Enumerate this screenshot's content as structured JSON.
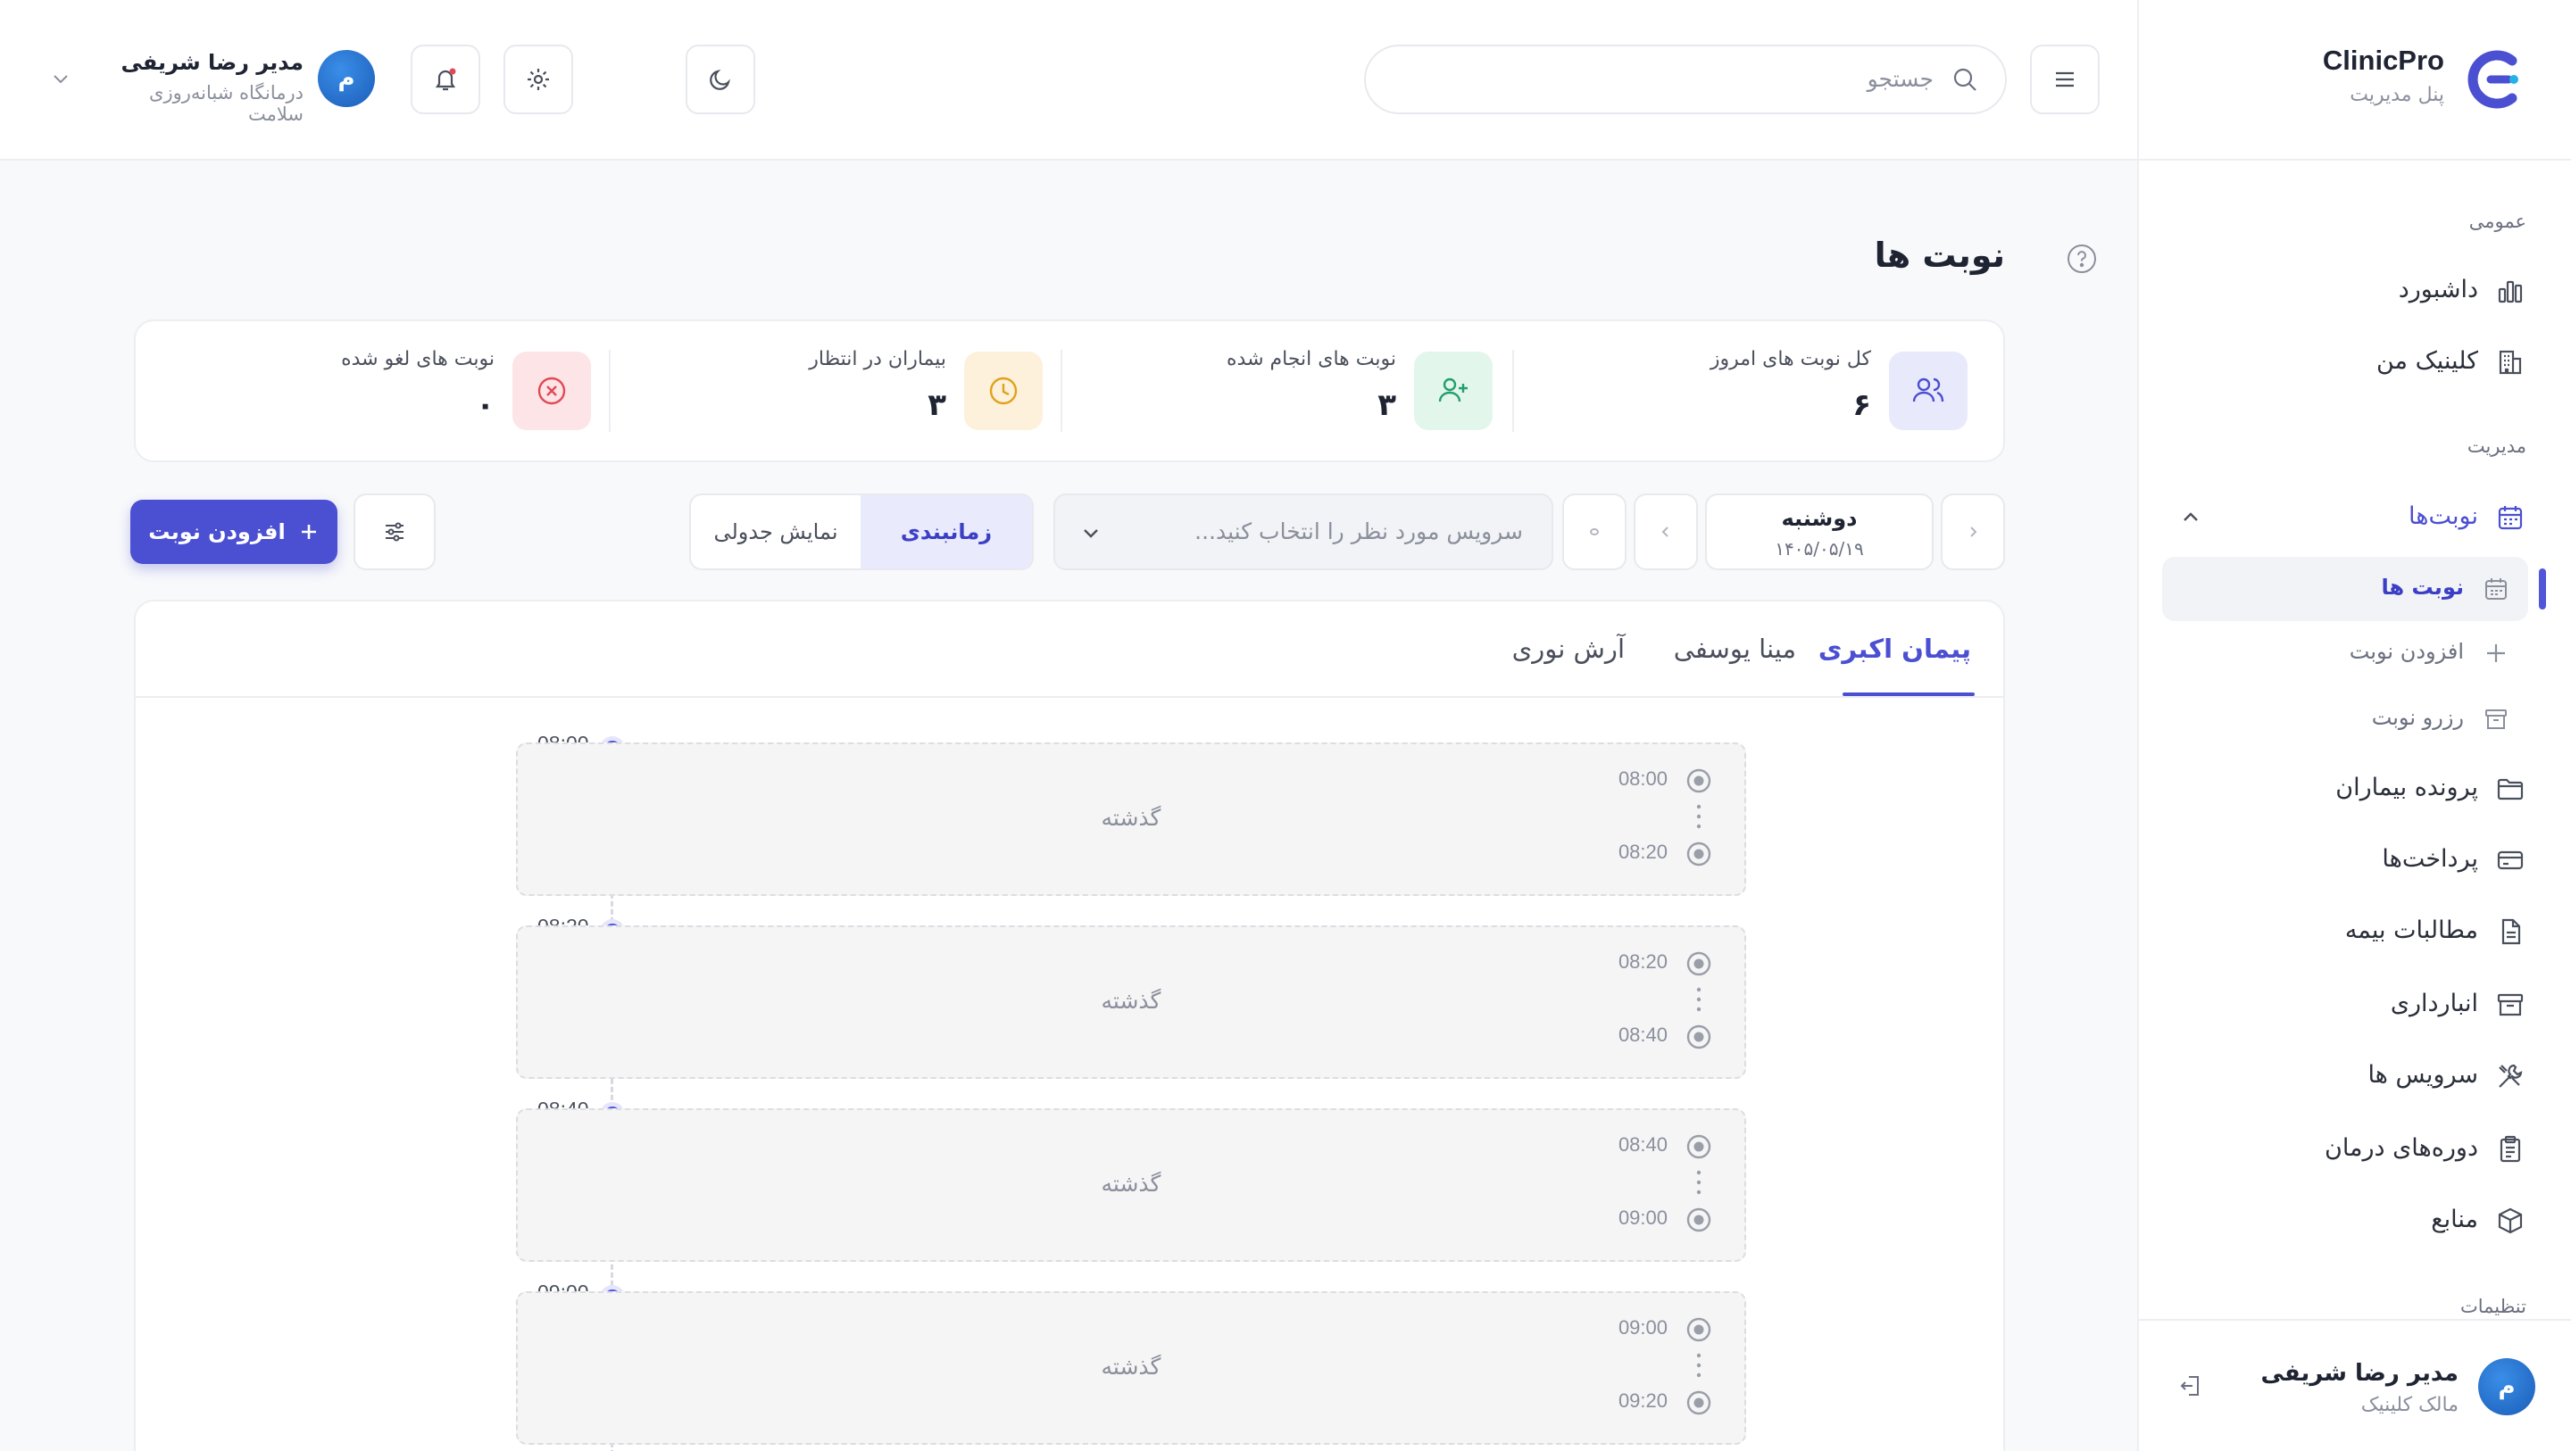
{
  "brand": {
    "name": "ClinicPro",
    "subtitle": "پنل مدیریت"
  },
  "topbar": {
    "search_placeholder": "جستجو",
    "user": {
      "name": "مدیر رضا شریفی",
      "org": "درمانگاه شبانه‌روزی سلامت",
      "avatar_letter": "م"
    }
  },
  "sidebar": {
    "sections": {
      "general": "عمومی",
      "management": "مدیریت",
      "settings": "تنظیمات"
    },
    "dashboard": "داشبورد",
    "my_clinic": "کلینیک من",
    "appointments": "نوبت‌ها",
    "sub": {
      "list": "نوبت ها",
      "add": "افزودن نوبت",
      "reserve": "رزرو نوبت"
    },
    "patients": "پرونده بیماران",
    "payments": "پرداخت‌ها",
    "insurance": "مطالبات بیمه",
    "inventory": "انبارداری",
    "services": "سرویس ها",
    "courses": "دوره‌های درمان",
    "resources": "منابع",
    "footer_user": {
      "name": "مدیر رضا شریفی",
      "role": "مالک کلینیک",
      "avatar_letter": "م"
    }
  },
  "page": {
    "title": "نوبت ها"
  },
  "stats": [
    {
      "label": "کل نوبت های امروز",
      "value": "۶"
    },
    {
      "label": "نوبت های انجام شده",
      "value": "۳"
    },
    {
      "label": "بیماران در انتظار",
      "value": "۳"
    },
    {
      "label": "نوبت های لغو شده",
      "value": "۰"
    }
  ],
  "toolbar": {
    "day": "دوشنبه",
    "date": "۱۴۰۵/۰۵/۱۹",
    "service_placeholder": "سرویس مورد نظر را انتخاب کنید...",
    "view_table": "نمایش جدولی",
    "view_schedule": "زمانبندی",
    "add_button": "افزودن نوبت"
  },
  "doctor_tabs": [
    "پیمان اکبری",
    "مینا یوسفی",
    "آرش نوری"
  ],
  "slots": [
    {
      "time": "08:00",
      "start": "08:00",
      "end": "08:20",
      "status": "گذشته"
    },
    {
      "time": "08:20",
      "start": "08:20",
      "end": "08:40",
      "status": "گذشته"
    },
    {
      "time": "08:40",
      "start": "08:40",
      "end": "09:00",
      "status": "گذشته"
    },
    {
      "time": "09:00",
      "start": "09:00",
      "end": "09:20",
      "status": "گذشته"
    }
  ],
  "colors": {
    "accent": "#5155d8",
    "green": "#22a06b",
    "amber": "#e0a21a",
    "red": "#e04a55"
  }
}
